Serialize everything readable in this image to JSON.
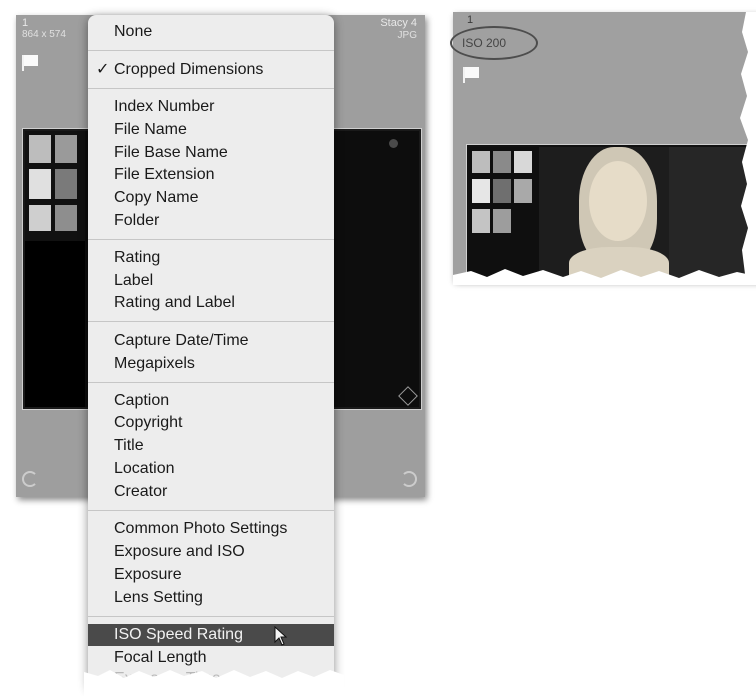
{
  "left_cell": {
    "index": "1",
    "dimensions": "864 x 574",
    "name": "Stacy 4",
    "extension": "JPG"
  },
  "menu": {
    "items": [
      {
        "label": "None",
        "checked": false,
        "highlighted": false
      },
      {
        "label": "Cropped Dimensions",
        "checked": true,
        "highlighted": false
      },
      {
        "label": "Index Number",
        "checked": false,
        "highlighted": false
      },
      {
        "label": "File Name",
        "checked": false,
        "highlighted": false
      },
      {
        "label": "File Base Name",
        "checked": false,
        "highlighted": false
      },
      {
        "label": "File Extension",
        "checked": false,
        "highlighted": false
      },
      {
        "label": "Copy Name",
        "checked": false,
        "highlighted": false
      },
      {
        "label": "Folder",
        "checked": false,
        "highlighted": false
      },
      {
        "label": "Rating",
        "checked": false,
        "highlighted": false
      },
      {
        "label": "Label",
        "checked": false,
        "highlighted": false
      },
      {
        "label": "Rating and Label",
        "checked": false,
        "highlighted": false
      },
      {
        "label": "Capture Date/Time",
        "checked": false,
        "highlighted": false
      },
      {
        "label": "Megapixels",
        "checked": false,
        "highlighted": false
      },
      {
        "label": "Caption",
        "checked": false,
        "highlighted": false
      },
      {
        "label": "Copyright",
        "checked": false,
        "highlighted": false
      },
      {
        "label": "Title",
        "checked": false,
        "highlighted": false
      },
      {
        "label": "Location",
        "checked": false,
        "highlighted": false
      },
      {
        "label": "Creator",
        "checked": false,
        "highlighted": false
      },
      {
        "label": "Common Photo Settings",
        "checked": false,
        "highlighted": false
      },
      {
        "label": "Exposure and ISO",
        "checked": false,
        "highlighted": false
      },
      {
        "label": "Exposure",
        "checked": false,
        "highlighted": false
      },
      {
        "label": "Lens Setting",
        "checked": false,
        "highlighted": false
      },
      {
        "label": "ISO Speed Rating",
        "checked": false,
        "highlighted": true
      },
      {
        "label": "Focal Length",
        "checked": false,
        "highlighted": false
      },
      {
        "label": "Exposure Time",
        "checked": false,
        "highlighted": false
      }
    ],
    "check_mark": "✓"
  },
  "right_cell": {
    "index": "1",
    "iso": "ISO 200"
  },
  "colors": {
    "cell_bg": "#9e9e9e",
    "menu_bg": "#ededed",
    "highlight": "#4a4a4a",
    "annotation": "#4d4d4d"
  }
}
